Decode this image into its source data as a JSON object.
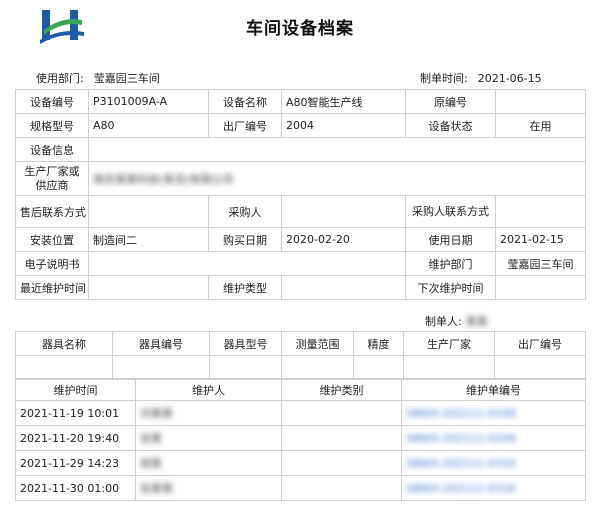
{
  "header": {
    "title": "车间设备档案",
    "dept_label": "使用部门:",
    "dept_value": "莹嘉园三车间",
    "date_label": "制单时间:",
    "date_value": "2021-06-15"
  },
  "equipment": {
    "code_label": "设备编号",
    "code_value": "P3101009A-A",
    "name_label": "设备名称",
    "name_value": "A80智能生产线",
    "orig_label": "原编号",
    "orig_value": "",
    "spec_label": "规格型号",
    "spec_value": "A80",
    "factory_no_label": "出厂编号",
    "factory_no_value": "2004",
    "status_label": "设备状态",
    "status_value": "在用",
    "info_label": "设备信息",
    "info_value": "",
    "maker_label": "生产厂家或供应商",
    "maker_value": "南京某某科技(青岛)有限公司",
    "aftersale_label": "售后联系方式",
    "aftersale_value": "",
    "buyer_label": "采购人",
    "buyer_value": "",
    "buyer_contact_label": "采购人联系方式",
    "buyer_contact_value": "",
    "install_label": "安装位置",
    "install_value": "制造间二",
    "buy_date_label": "购买日期",
    "buy_date_value": "2020-02-20",
    "use_date_label": "使用日期",
    "use_date_value": "2021-02-15",
    "manual_label": "电子说明书",
    "manual_value": "",
    "maint_dept_label": "维护部门",
    "maint_dept_value": "莹嘉园三车间",
    "last_maint_label": "最近维护时间",
    "last_maint_value": "",
    "maint_type_label": "维护类型",
    "maint_type_value": "",
    "next_maint_label": "下次维护时间",
    "next_maint_value": ""
  },
  "maker_line": {
    "label": "制单人:",
    "value": "某某"
  },
  "tools": {
    "headers": [
      "器具名称",
      "器具编号",
      "器具型号",
      "测量范围",
      "精度",
      "生产厂家",
      "出厂编号"
    ],
    "row": [
      "",
      "",
      "",
      "",
      "",
      "",
      ""
    ]
  },
  "maintenance": {
    "headers": [
      "维护时间",
      "维护人",
      "维护类别",
      "维护单编号"
    ],
    "rows": [
      {
        "time": "2021-11-19 10:01",
        "person": "刘某某",
        "type": "",
        "order": "SBWX-202111-0199"
      },
      {
        "time": "2021-11-20 19:40",
        "person": "张某",
        "type": "",
        "order": "SBWX-202111-0206"
      },
      {
        "time": "2021-11-29 14:23",
        "person": "胡某",
        "type": "",
        "order": "SBWX-202111-0310"
      },
      {
        "time": "2021-11-30 01:00",
        "person": "张某某",
        "type": "",
        "order": "SBWX-202111-0316"
      }
    ]
  },
  "colors": {
    "border": "#cfcfcf",
    "link": "#3a7bd5",
    "logo_blue": "#1e5aa8",
    "logo_green": "#3aa655"
  }
}
